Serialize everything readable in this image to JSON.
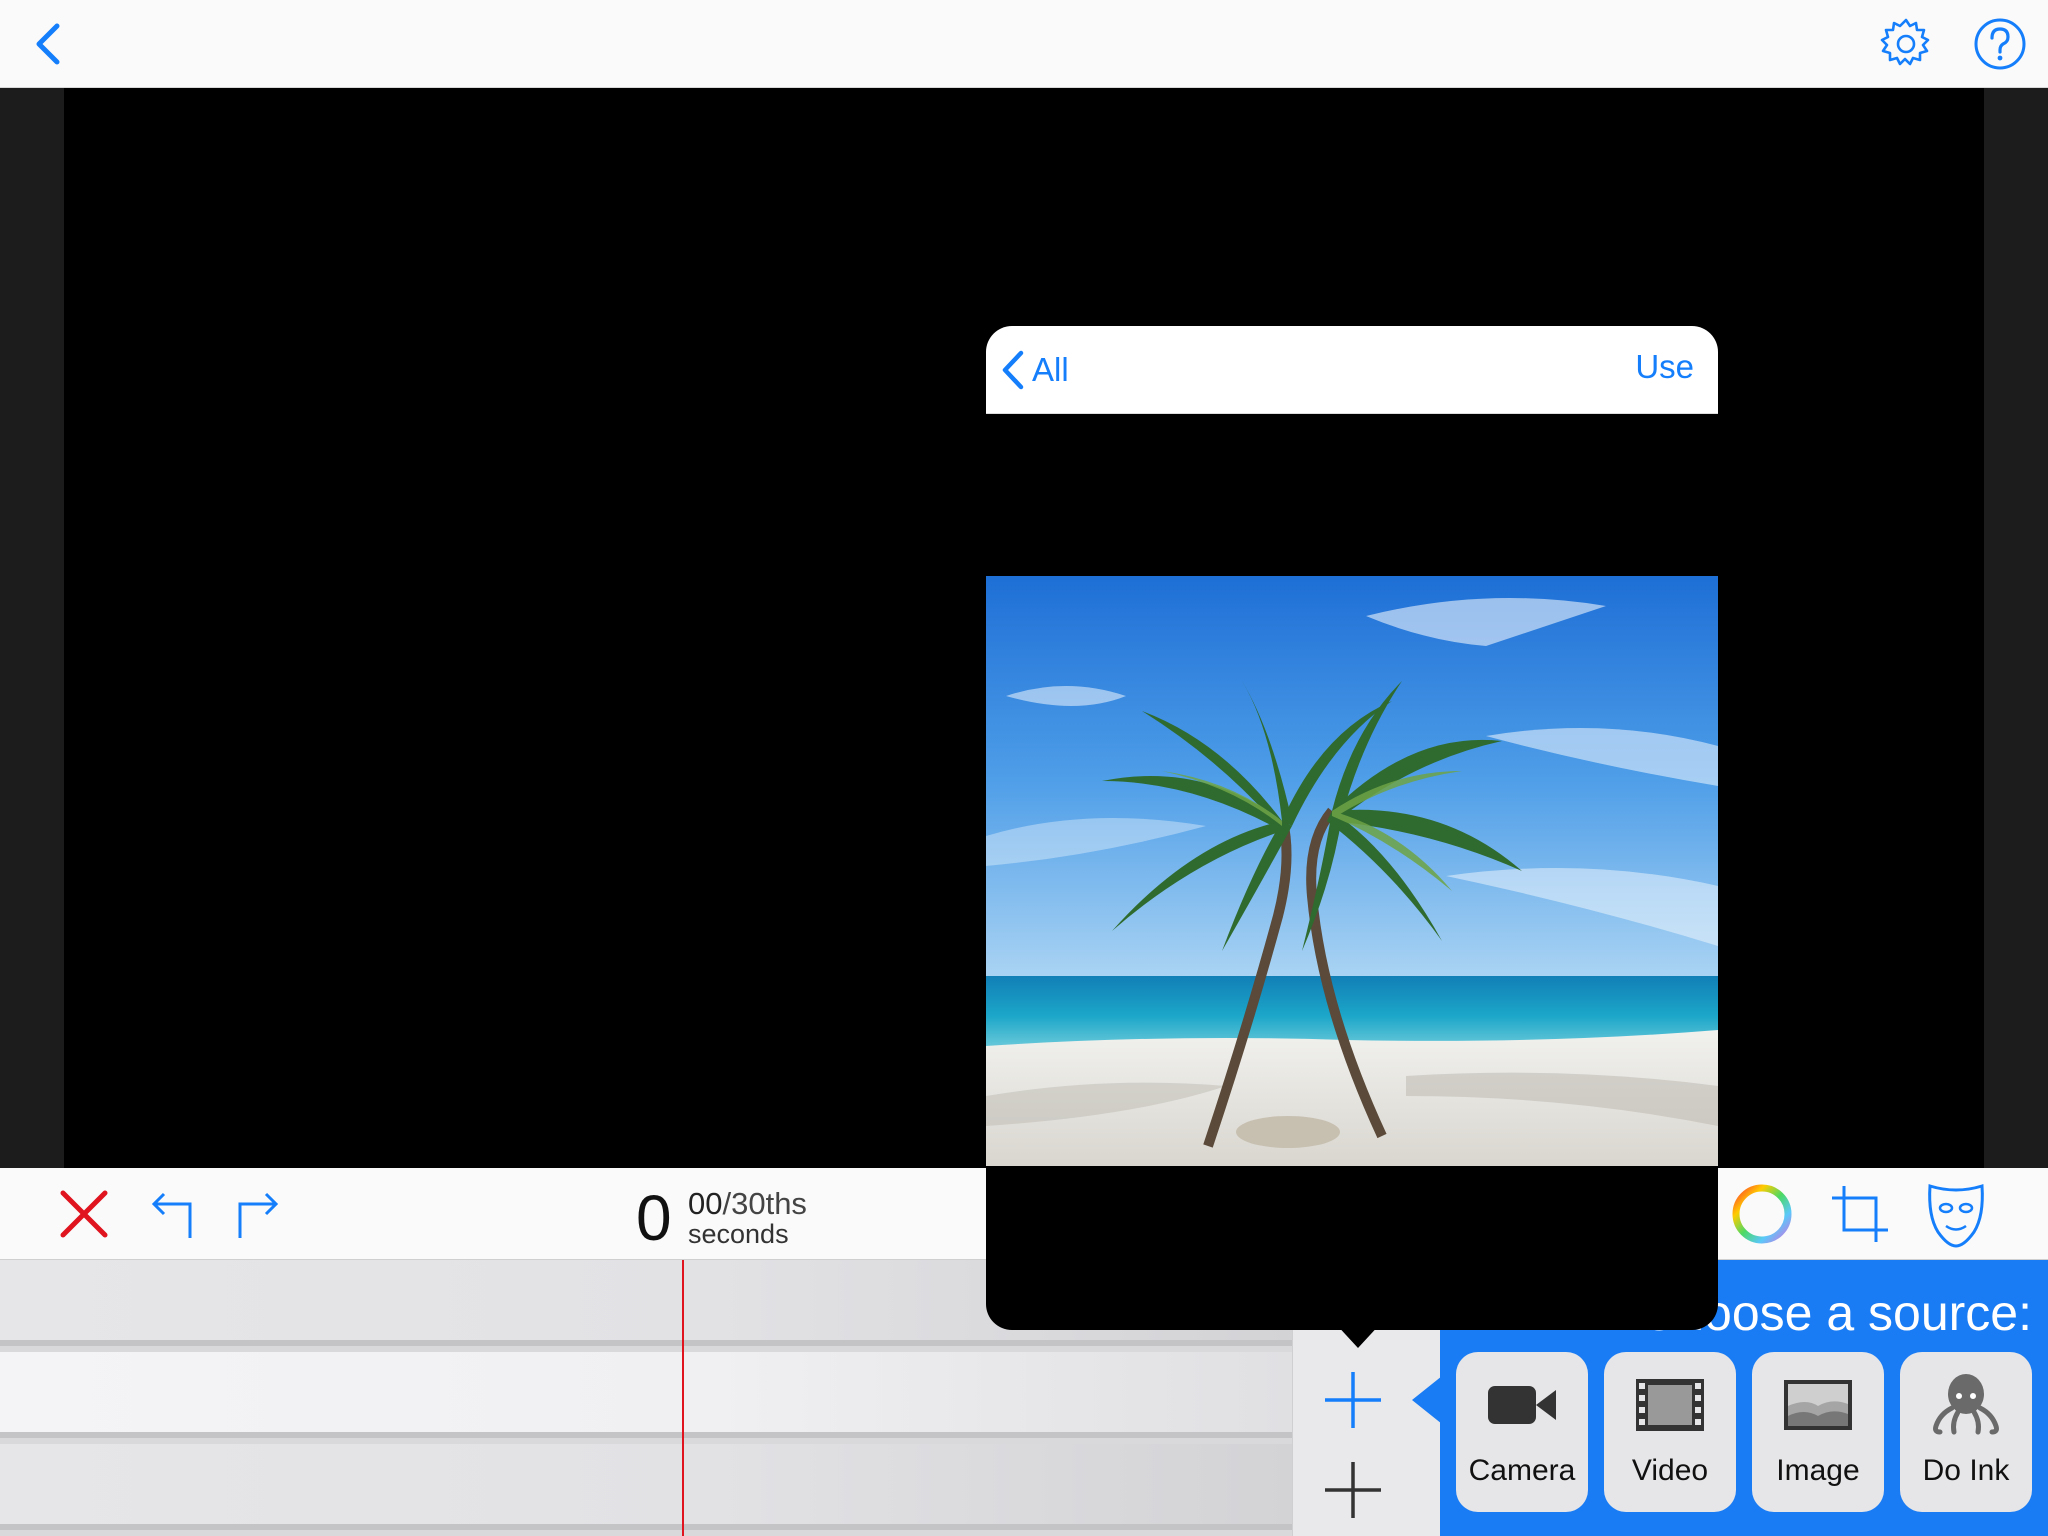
{
  "topbar": {
    "back_icon": "chevron-left-icon",
    "settings_icon": "gear-icon",
    "help_icon": "question-circle-icon"
  },
  "toolbar": {
    "delete_icon": "red-x-icon",
    "undo_icon": "undo-arrow-icon",
    "redo_icon": "redo-arrow-icon",
    "time_seconds": "0",
    "time_frames": "00",
    "time_frames_suffix": "/30ths",
    "time_unit": "seconds",
    "color_icon": "color-wheel-icon",
    "crop_icon": "crop-icon",
    "mask_icon": "mask-icon"
  },
  "picker": {
    "back_label": "All",
    "use_label": "Use",
    "photo_description": "palm-trees-beach-photo"
  },
  "source_panel": {
    "title": "Choose a source:",
    "buttons": [
      {
        "label": "Camera",
        "icon": "video-camera-icon"
      },
      {
        "label": "Video",
        "icon": "film-strip-icon"
      },
      {
        "label": "Image",
        "icon": "image-icon"
      },
      {
        "label": "Do Ink",
        "icon": "octopus-icon"
      }
    ]
  },
  "colors": {
    "accent": "#147efb",
    "source_panel": "#1a7cf4",
    "playhead": "#e0141e",
    "delete": "#e0141e"
  }
}
